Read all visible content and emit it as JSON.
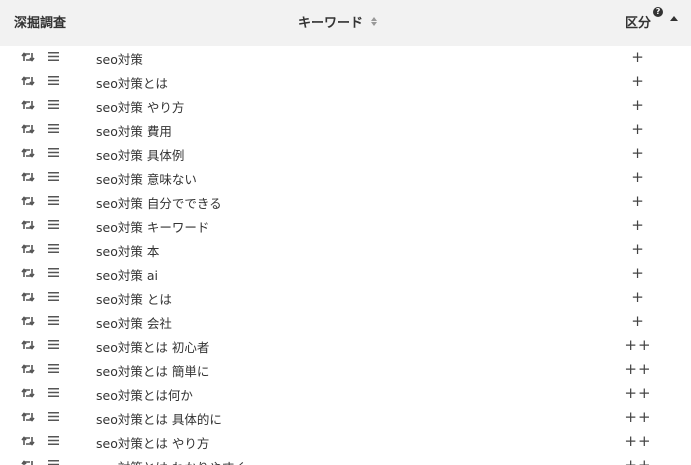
{
  "header": {
    "deep_label": "深掘調査",
    "keyword_label": "キーワード",
    "kubun_label": "区分",
    "help_glyph": "?"
  },
  "rows": [
    {
      "keyword": "seo対策",
      "kubun": "+"
    },
    {
      "keyword": "seo対策とは",
      "kubun": "+"
    },
    {
      "keyword": "seo対策 やり方",
      "kubun": "+"
    },
    {
      "keyword": "seo対策 費用",
      "kubun": "+"
    },
    {
      "keyword": "seo対策 具体例",
      "kubun": "+"
    },
    {
      "keyword": "seo対策 意味ない",
      "kubun": "+"
    },
    {
      "keyword": "seo対策 自分でできる",
      "kubun": "+"
    },
    {
      "keyword": "seo対策 キーワード",
      "kubun": "+"
    },
    {
      "keyword": "seo対策 本",
      "kubun": "+"
    },
    {
      "keyword": "seo対策 ai",
      "kubun": "+"
    },
    {
      "keyword": "seo対策 とは",
      "kubun": "+"
    },
    {
      "keyword": "seo対策 会社",
      "kubun": "+"
    },
    {
      "keyword": "seo対策とは 初心者",
      "kubun": "++"
    },
    {
      "keyword": "seo対策とは 簡単に",
      "kubun": "++"
    },
    {
      "keyword": "seo対策とは何か",
      "kubun": "++"
    },
    {
      "keyword": "seo対策とは 具体的に",
      "kubun": "++"
    },
    {
      "keyword": "seo対策とは やり方",
      "kubun": "++"
    },
    {
      "keyword": "seo対策とは わかりやすく",
      "kubun": "++"
    }
  ]
}
